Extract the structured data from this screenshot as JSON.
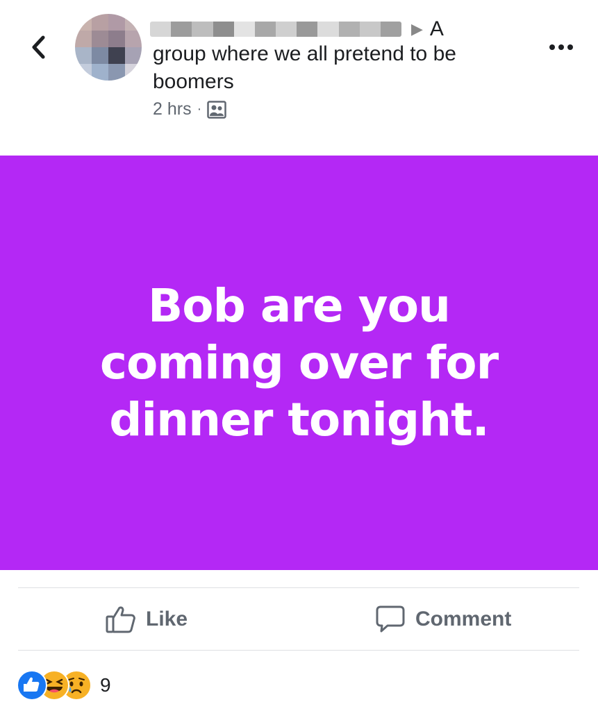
{
  "header": {
    "author_name_redacted": true,
    "group_name_first_word": "A",
    "group_name_rest": "group where we all pretend to be boomers",
    "timestamp": "2 hrs",
    "separator": "·",
    "audience_icon": "group-audience-icon",
    "back_icon": "chevron-left-icon",
    "more_icon": "more-horizontal-icon"
  },
  "post": {
    "text": "Bob are you coming over for dinner tonight.",
    "background_color": "#b428f5",
    "text_color": "#ffffff"
  },
  "actions": {
    "like_label": "Like",
    "comment_label": "Comment",
    "like_icon": "thumbs-up-outline-icon",
    "comment_icon": "speech-bubble-icon"
  },
  "reactions": {
    "types": [
      "like",
      "haha",
      "sad"
    ],
    "count": "9"
  }
}
